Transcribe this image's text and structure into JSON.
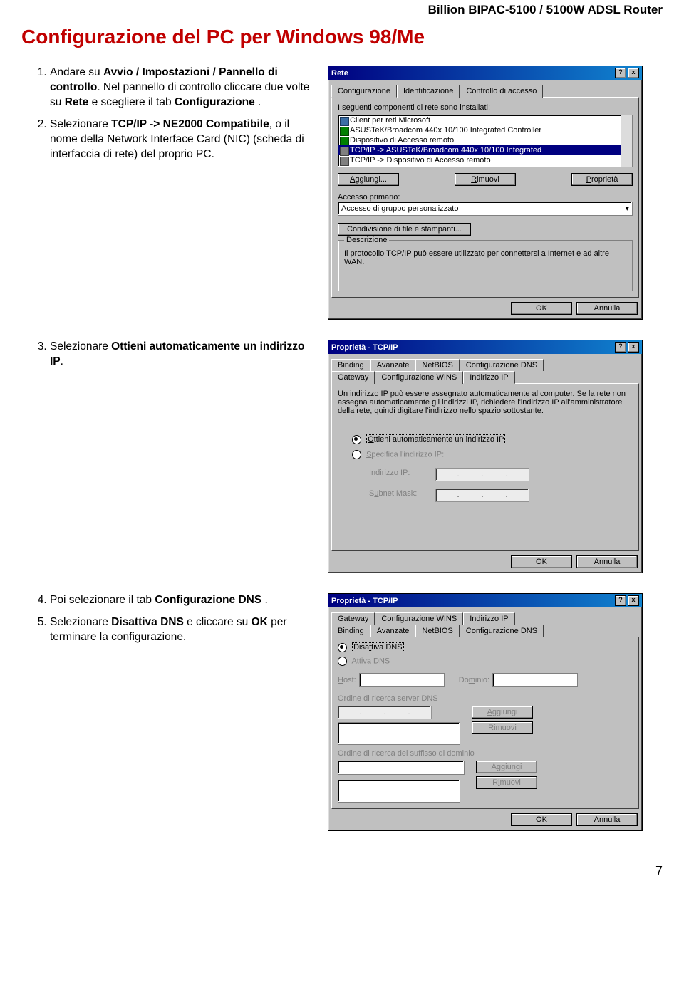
{
  "header": "Billion BIPAC-5100 / 5100W ADSL Router",
  "title": "Configurazione del PC per Windows 98/Me",
  "page_number": "7",
  "step1": {
    "num": "1.",
    "pre": "Andare su ",
    "b1": "Avvio / Impostazioni / Pannello di controllo",
    "post1": ". Nel pannello di controllo cliccare due volte su ",
    "b2": "Rete",
    "post2": " e scegliere il tab ",
    "b3": "Configurazione",
    "post3": " ."
  },
  "step2": {
    "num": "2.",
    "pre": "Selezionare ",
    "b1": "TCP/IP -> NE2000 Compatibile",
    "post": ", o il nome della Network Interface Card (NIC) (scheda di interfaccia di rete) del proprio PC."
  },
  "step3": {
    "num": "3.",
    "pre": "Selezionare ",
    "b1": "Ottieni automaticamente un indirizzo IP",
    "post": "."
  },
  "step4": {
    "num": "4.",
    "pre": "Poi selezionare il tab ",
    "b1": "Configurazione DNS",
    "post": " ."
  },
  "step5": {
    "num": "5.",
    "pre": "Selezionare ",
    "b1": "Disattiva DNS",
    "post1": " e cliccare su ",
    "b2": "OK",
    "post2": " per terminare la configurazione."
  },
  "dlg1": {
    "title": "Rete",
    "help": "?",
    "close": "x",
    "tab_conf": "Configurazione",
    "tab_ident": "Identificazione",
    "tab_access": "Controllo di accesso",
    "components_label": "I seguenti componenti di rete sono installati:",
    "items": {
      "i1": "Client per reti Microsoft",
      "i2": "ASUSTeK/Broadcom 440x 10/100 Integrated Controller",
      "i3": "Dispositivo di Accesso remoto",
      "i4": "TCP/IP -> ASUSTeK/Broadcom 440x 10/100 Integrated",
      "i5": "TCP/IP -> Dispositivo di Accesso remoto"
    },
    "btn_add": "Aggiungi...",
    "btn_remove": "Rimuovi",
    "btn_prop": "Proprietà",
    "primary_access": "Accesso primario:",
    "primary_value": "Accesso di gruppo personalizzato",
    "file_print": "Condivisione di file e stampanti...",
    "desc_label": "Descrizione",
    "desc_text": "Il protocollo TCP/IP può essere utilizzato per connettersi a Internet e ad altre WAN.",
    "ok": "OK",
    "cancel": "Annulla"
  },
  "dlg2": {
    "title": "Proprietà - TCP/IP",
    "tab_binding": "Binding",
    "tab_adv": "Avanzate",
    "tab_netbios": "NetBIOS",
    "tab_dns": "Configurazione DNS",
    "tab_gateway": "Gateway",
    "tab_wins": "Configurazione WINS",
    "tab_ip": "Indirizzo IP",
    "intro": "Un indirizzo IP può essere assegnato automaticamente al computer. Se la rete non assegna automaticamente gli indirizzi IP, richiedere l'indirizzo IP all'amministratore della rete, quindi digitare l'indirizzo nello spazio sottostante.",
    "radio_auto": "Ottieni automaticamente un indirizzo IP",
    "radio_spec": "Specifica l'indirizzo IP:",
    "ip_label": "Indirizzo IP:",
    "mask_label": "Subnet Mask:",
    "ok": "OK",
    "cancel": "Annulla"
  },
  "dlg3": {
    "title": "Proprietà - TCP/IP",
    "tab_gateway": "Gateway",
    "tab_wins": "Configurazione WINS",
    "tab_ip": "Indirizzo IP",
    "tab_binding": "Binding",
    "tab_adv": "Avanzate",
    "tab_netbios": "NetBIOS",
    "tab_dns": "Configurazione DNS",
    "radio_off": "Disattiva DNS",
    "radio_on": "Attiva DNS",
    "host": "Host:",
    "domain": "Dominio:",
    "order_dns": "Ordine di ricerca server DNS",
    "btn_add": "Aggiungi",
    "btn_remove": "Rimuovi",
    "order_suffix": "Ordine di ricerca del suffisso di dominio",
    "ok": "OK",
    "cancel": "Annulla"
  }
}
